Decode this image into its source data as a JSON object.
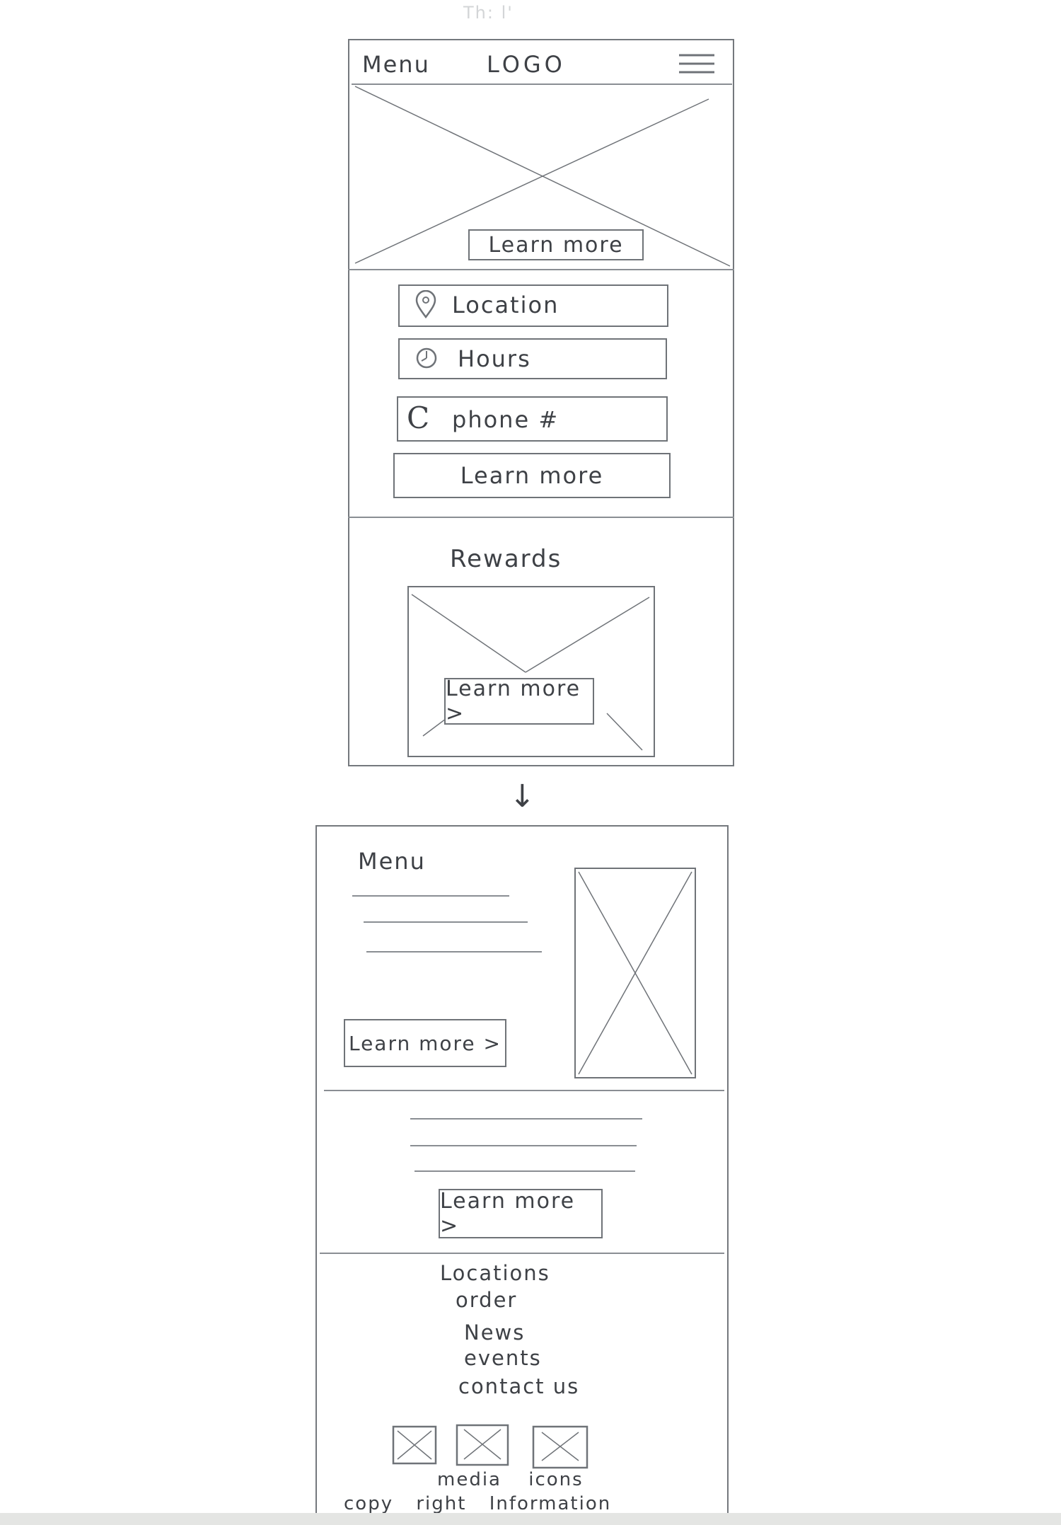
{
  "faint_header": "Th: l'",
  "screen1": {
    "header": {
      "menu_label": "Menu",
      "logo_label": "LOGO"
    },
    "hero": {
      "button_label": "Learn more"
    },
    "info": {
      "location_label": "Location",
      "hours_label": "Hours",
      "phone_icon_glyph": "C",
      "phone_label": "phone #",
      "button_label": "Learn more"
    },
    "rewards": {
      "title": "Rewards",
      "button_label": "Learn more >"
    }
  },
  "arrow_glyph": "↓",
  "screen2": {
    "menu_section": {
      "title": "Menu",
      "button_label": "Learn more >"
    },
    "text_section": {
      "button_label": "Learn more >"
    },
    "footer": {
      "links": [
        "Locations",
        "order",
        "News",
        "events",
        "contact us"
      ],
      "media_caption": "media icons",
      "copyright": "copy right Information"
    }
  },
  "colors": {
    "ink": "#6f7378",
    "text": "#3e4146",
    "paper": "#ffffff",
    "scan_strip": "#e4e5e3"
  }
}
